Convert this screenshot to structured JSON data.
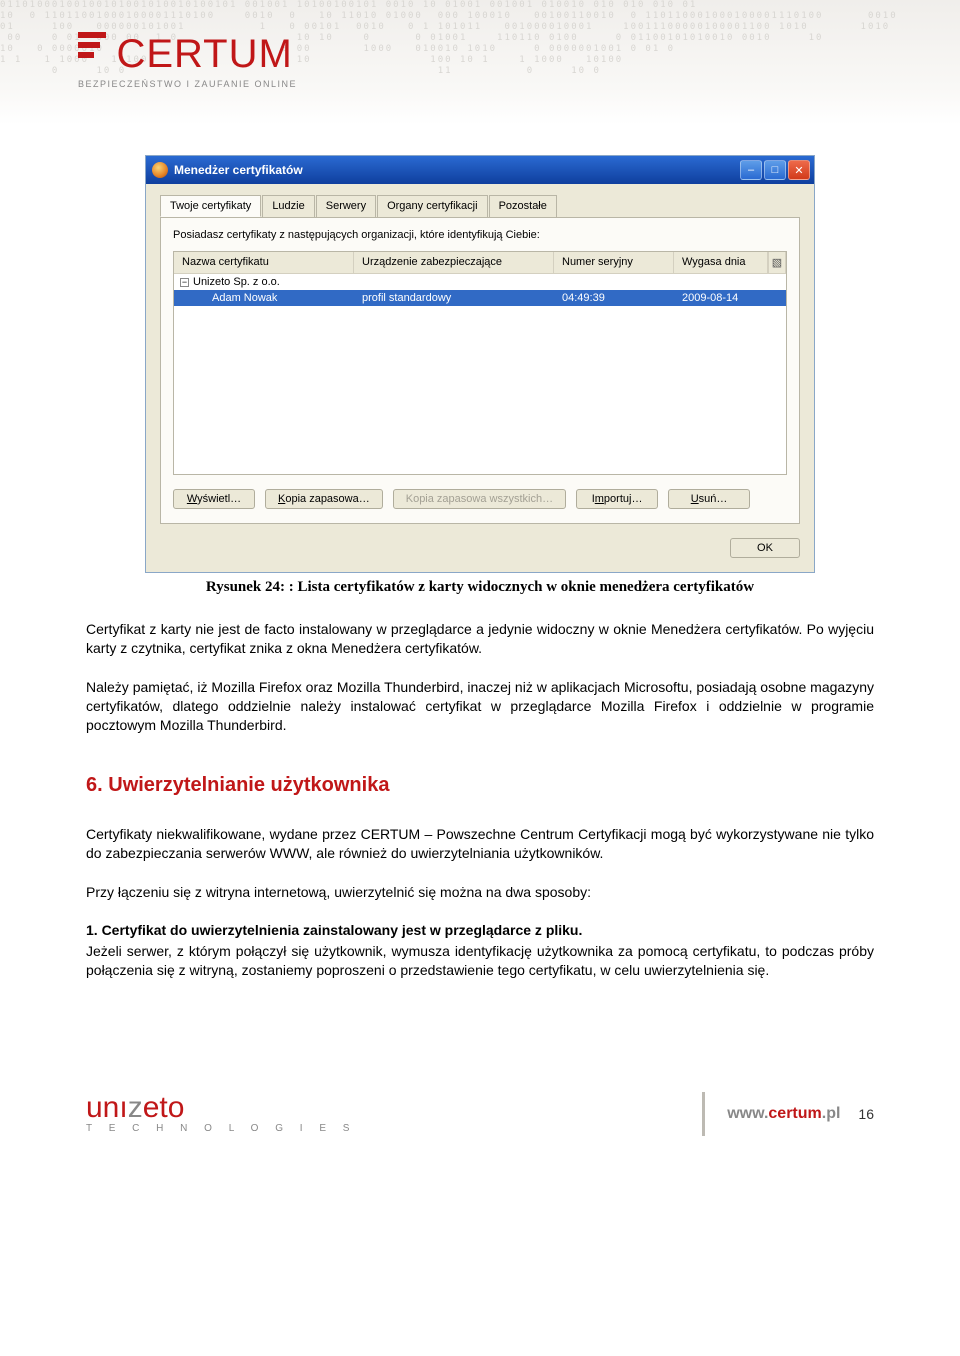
{
  "header": {
    "logo_text": "CERTUM",
    "logo_subtitle": "BEZPIECZEŃSTWO I ZAUFANIE ONLINE"
  },
  "dialog": {
    "title": "Menedżer certyfikatów",
    "tabs": [
      "Twoje certyfikaty",
      "Ludzie",
      "Serwery",
      "Organy certyfikacji",
      "Pozostałe"
    ],
    "active_tab": 0,
    "description": "Posiadasz certyfikaty z następujących organizacji, które identyfikują Ciebie:",
    "columns": {
      "name": "Nazwa certyfikatu",
      "device": "Urządzenie zabezpieczające",
      "serial": "Numer seryjny",
      "expiry": "Wygasa dnia"
    },
    "group": "Unizeto Sp. z o.o.",
    "rows": [
      {
        "name": "Adam Nowak",
        "device": "profil standardowy",
        "serial": "04:49:39",
        "expiry": "2009-08-14"
      }
    ],
    "buttons": {
      "view": "Wyświetl…",
      "backup": "Kopia zapasowa…",
      "backup_all": "Kopia zapasowa wszystkich…",
      "import": "Importuj…",
      "delete": "Usuń…",
      "ok": "OK"
    }
  },
  "caption": "Rysunek 24: : Lista certyfikatów z karty widocznych w oknie menedżera certyfikatów",
  "para1": "Certyfikat z karty nie jest de facto instalowany w przeglądarce a jedynie widoczny w oknie Menedżera certyfikatów. Po wyjęciu karty z czytnika, certyfikat znika z okna Menedżera certyfikatów.",
  "para2": "Należy pamiętać, iż Mozilla Firefox oraz Mozilla Thunderbird, inaczej niż w aplikacjach Microsoftu, posiadają osobne magazyny certyfikatów, dlatego oddzielnie należy instalować certyfikat w przeglądarce Mozilla Firefox i oddzielnie w programie pocztowym Mozilla Thunderbird.",
  "section": {
    "number": "6.",
    "title": "Uwierzytelnianie użytkownika"
  },
  "para3": "Certyfikaty niekwalifikowane, wydane przez CERTUM – Powszechne Centrum Certyfikacji mogą być wykorzystywane nie tylko do zabezpieczania serwerów WWW, ale również do uwierzytelniania użytkowników.",
  "para4": "Przy łączeniu się z witryna internetową, uwierzytelnić się można na dwa sposoby:",
  "bold5": "1. Certyfikat do uwierzytelnienia zainstalowany jest w przeglądarce z pliku.",
  "para5": "Jeżeli serwer, z którym połączył się użytkownik, wymusza identyfikację użytkownika za pomocą certyfikatu, to podczas próby połączenia się z witryną, zostaniemy poproszeni o przedstawienie tego certyfikatu, w celu uwierzytelnienia się.",
  "footer": {
    "unizeto": "unızeto",
    "unizeto_sub": "T E C H N O L O G I E S",
    "site_grey": "www.",
    "site_red": "certum",
    "site_grey2": ".pl",
    "page": "16"
  }
}
